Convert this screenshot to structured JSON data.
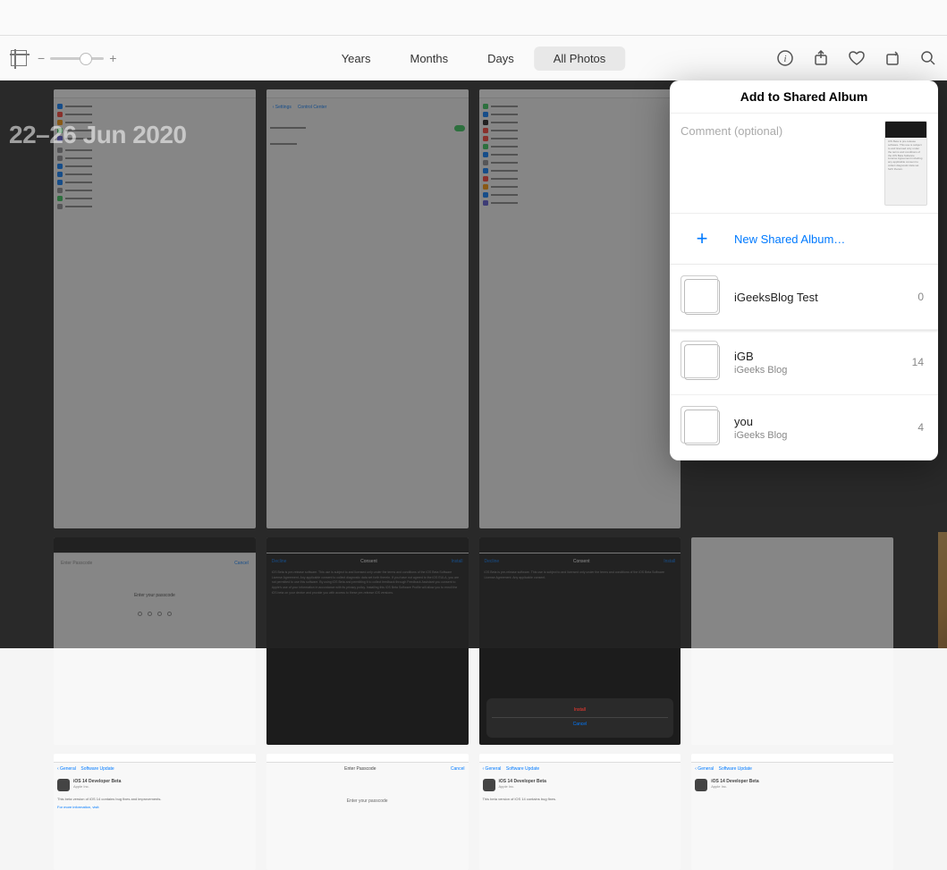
{
  "toolbar": {
    "tabs": [
      "Years",
      "Months",
      "Days",
      "All Photos"
    ],
    "active_tab": "All Photos",
    "zoom_minus": "−",
    "zoom_plus": "+"
  },
  "grid": {
    "date_label": "22–26 Jun 2020"
  },
  "popover": {
    "title": "Add to Shared Album",
    "comment_placeholder": "Comment (optional)",
    "new_album_label": "New Shared Album…",
    "albums": [
      {
        "name": "iGeeksBlog Test",
        "subtitle": "",
        "count": "0",
        "selected": true
      },
      {
        "name": "iGB",
        "subtitle": "iGeeks Blog",
        "count": "14",
        "selected": false
      },
      {
        "name": "you",
        "subtitle": "iGeeks Blog",
        "count": "4",
        "selected": false
      }
    ]
  },
  "thumbs": {
    "settings_labels": [
      "Settings",
      "Control Center"
    ],
    "icon_colors": [
      "#007aff",
      "#ff3b30",
      "#ff9500",
      "#34c759",
      "#5856d6",
      "#ff2d55",
      "#8e8e93",
      "#007aff",
      "#34c759",
      "#ff9500",
      "#5856d6"
    ]
  }
}
